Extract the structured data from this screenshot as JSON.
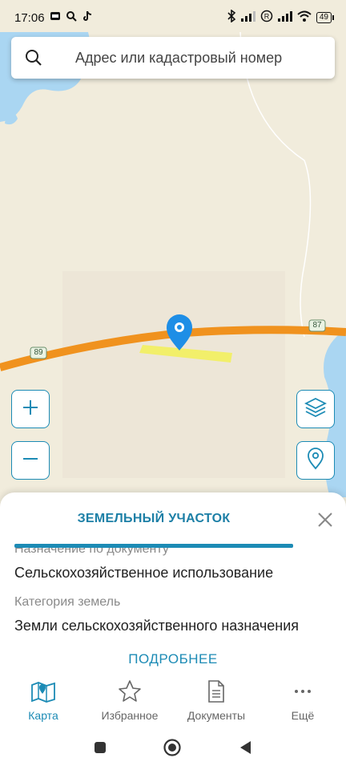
{
  "status_bar": {
    "time": "17:06",
    "battery": "49"
  },
  "search": {
    "placeholder": "Адрес или кадастровый номер"
  },
  "map": {
    "road_labels": [
      "89",
      "87"
    ],
    "colors": {
      "land": "#f1ecdc",
      "water": "#aad6f2",
      "road": "#f0921e",
      "parcel": "#f2ef6a",
      "marker": "#1e8ee6"
    }
  },
  "sheet": {
    "title": "ЗЕМЕЛЬНЫЙ УЧАСТОК",
    "fields": [
      {
        "label": "Назначение по документу",
        "value": "Сельскохозяйственное использование"
      },
      {
        "label": "Категория земель",
        "value": "Земли сельскохозяйственного назначения"
      }
    ],
    "more_label": "ПОДРОБНЕЕ"
  },
  "nav": {
    "items": [
      {
        "label": "Карта",
        "icon": "map-icon",
        "active": true
      },
      {
        "label": "Избранное",
        "icon": "star-icon",
        "active": false
      },
      {
        "label": "Документы",
        "icon": "document-icon",
        "active": false
      },
      {
        "label": "Ещё",
        "icon": "more-icon",
        "active": false
      }
    ]
  },
  "accent_color": "#1c8bb5"
}
